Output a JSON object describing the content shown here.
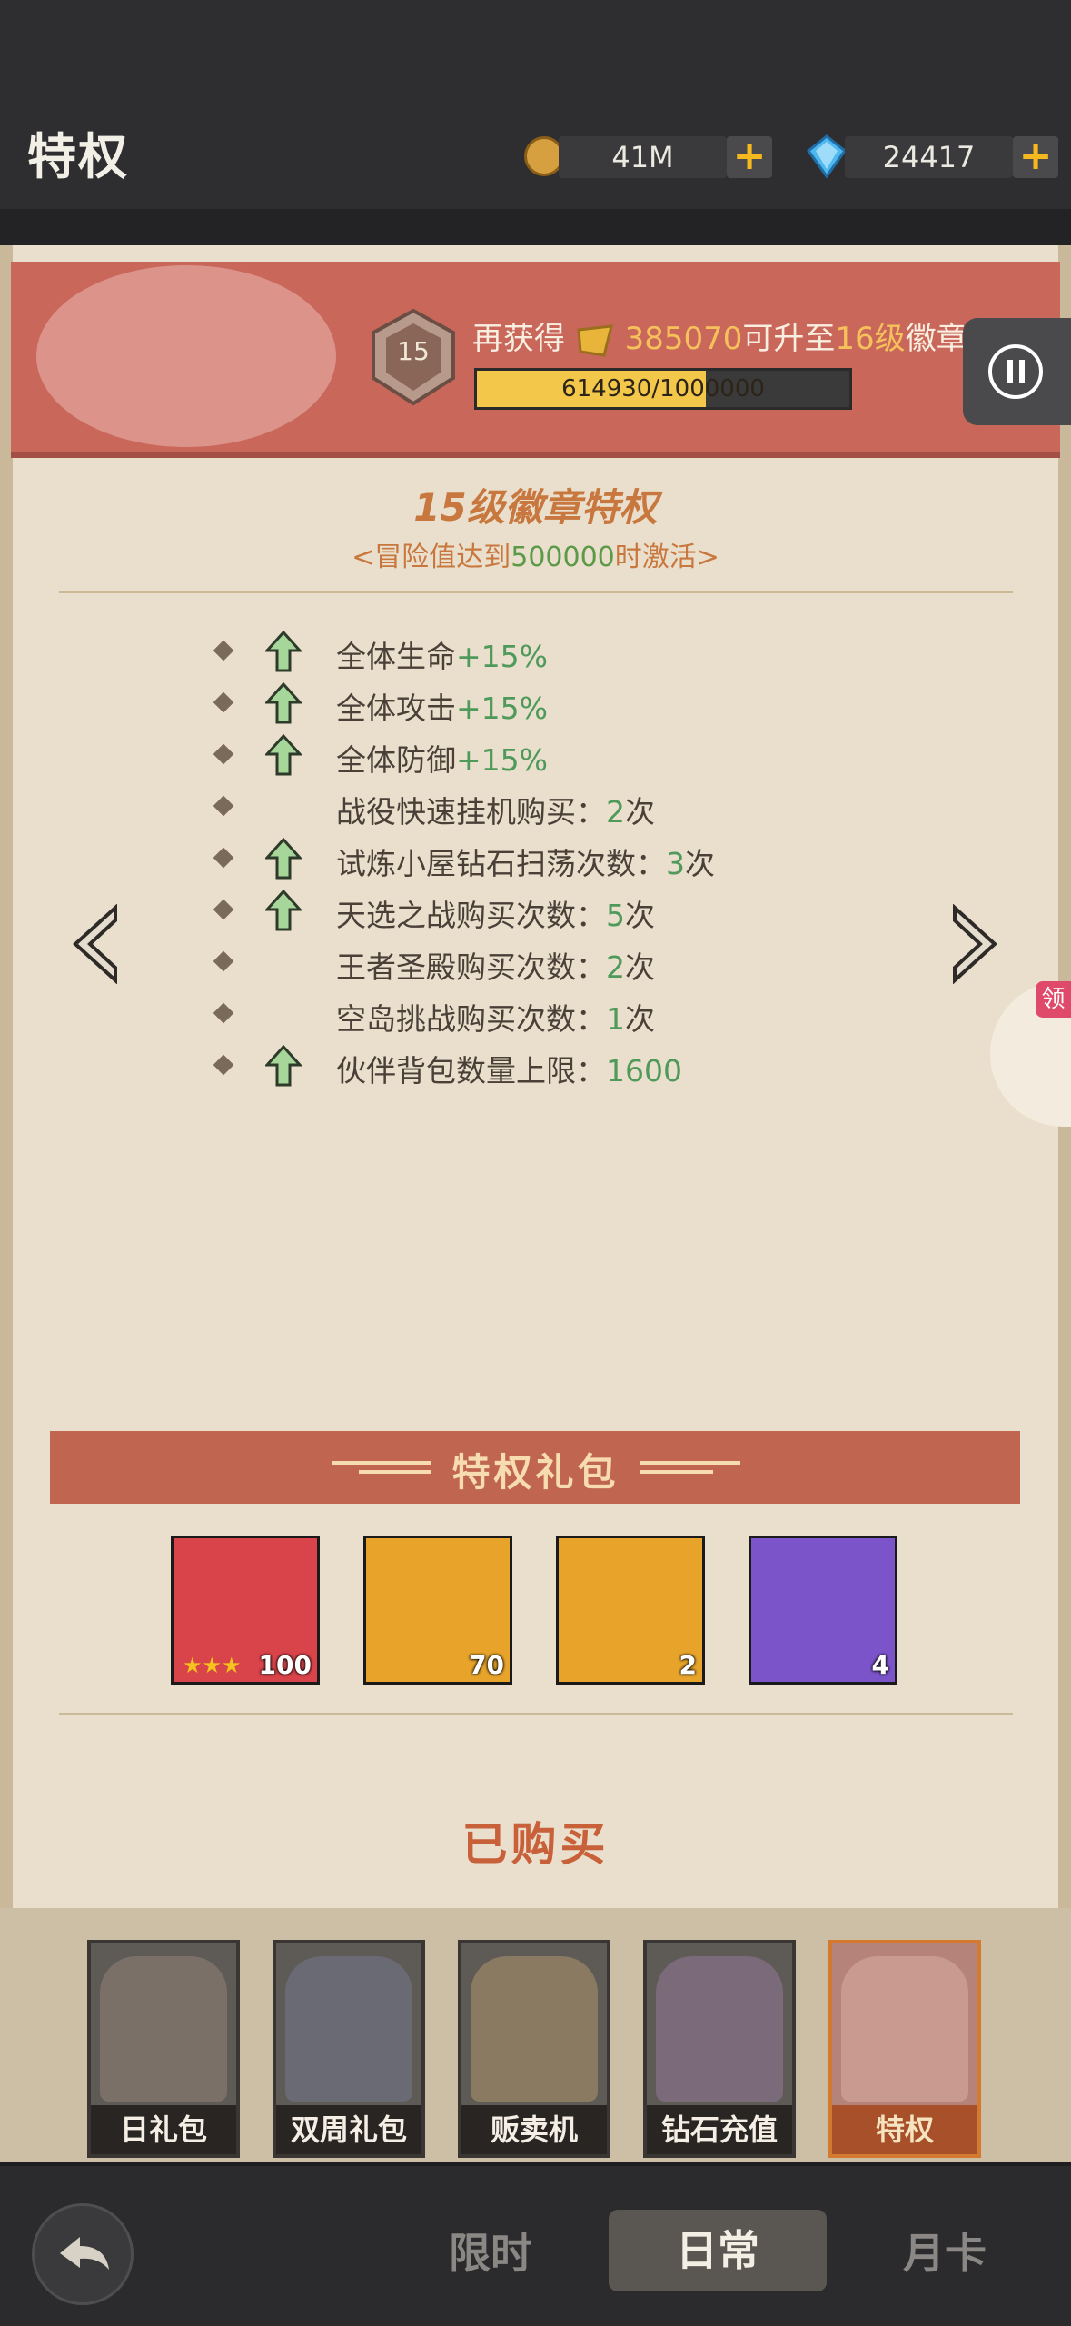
{
  "header": {
    "title": "特权",
    "coins": "41M",
    "gems": "24417",
    "plus": "+"
  },
  "badge": {
    "level": "15",
    "upgrade_prefix": "再获得",
    "upgrade_amount": "385070",
    "upgrade_suffix_pre": "可升至",
    "upgrade_target": "16级",
    "upgrade_suffix": "徽章",
    "progress_text": "614930/1000000",
    "progress_fraction": 0.61493
  },
  "privilege": {
    "title": "15级徽章特权",
    "sub_pre": "<冒险值达到",
    "sub_value": "500000",
    "sub_post": "时激活>",
    "items": [
      {
        "label": "全体生命",
        "value": "+15%",
        "arrow": true
      },
      {
        "label": "全体攻击",
        "value": "+15%",
        "arrow": true
      },
      {
        "label": "全体防御",
        "value": "+15%",
        "arrow": true
      },
      {
        "label": "战役快速挂机购买：",
        "value": "2",
        "suffix": "次",
        "arrow": false
      },
      {
        "label": "试炼小屋钻石扫荡次数：",
        "value": "3",
        "suffix": "次",
        "arrow": true
      },
      {
        "label": "天选之战购买次数：",
        "value": "5",
        "suffix": "次",
        "arrow": true
      },
      {
        "label": "王者圣殿购买次数：",
        "value": "2",
        "suffix": "次",
        "arrow": false
      },
      {
        "label": "空岛挑战购买次数：",
        "value": "1",
        "suffix": "次",
        "arrow": false
      },
      {
        "label": "伙伴背包数量上限：",
        "value": "1600",
        "suffix": "",
        "arrow": true
      }
    ]
  },
  "side_tab": {
    "label": "领"
  },
  "gift": {
    "title": "特权礼包",
    "items": [
      {
        "count": "100",
        "stars": "★★★",
        "color": "#d8444a"
      },
      {
        "count": "70",
        "color": "#e8a42a"
      },
      {
        "count": "2",
        "color": "#e8a42a"
      },
      {
        "count": "4",
        "color": "#7a54c8"
      }
    ],
    "status": "已购买"
  },
  "heroes": [
    {
      "label": "日礼包"
    },
    {
      "label": "双周礼包"
    },
    {
      "label": "贩卖机"
    },
    {
      "label": "钻石充值"
    },
    {
      "label": "特权"
    }
  ],
  "tabs": [
    {
      "label": "限时"
    },
    {
      "label": "日常"
    },
    {
      "label": "月卡"
    }
  ],
  "colors": {
    "accent_orange": "#c8783e",
    "value_green": "#4f9a5a",
    "gold": "#f6c05a"
  }
}
